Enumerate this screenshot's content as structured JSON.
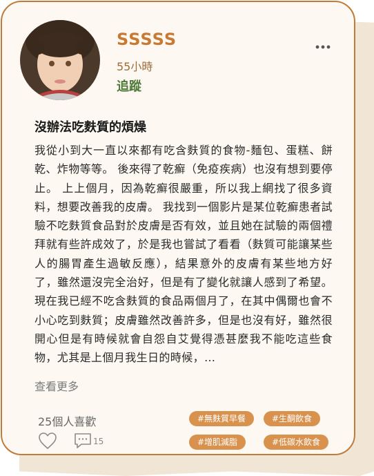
{
  "post": {
    "username": "SSSSS",
    "time": "55小時",
    "follow_label": "追蹤",
    "title": "沒辦法吃麩質的煩燥",
    "body": "我從小到大一直以來都有吃含麩質的食物-麵包、蛋糕、餅乾、炸物等等。 後來得了乾癬（免疫疾病）也沒有想到要停止。 上上個月，因為乾癬很嚴重，所以我上網找了很多資料，想要改善我的皮膚。 我找到一個影片是某位乾癬患者試驗不吃麩質食品對於皮膚是否有效，並且她在試驗的兩個禮拜就有些許成效了，於是我也嘗試了看看（麩質可能讓某些人的腸胃產生過敏反應），結果意外的皮膚有某些地方好了，雖然還沒完全治好，但是有了變化就讓人感到了希望。 現在我已經不吃含麩質的食品兩個月了，在其中偶爾也會不小心吃到麩質；皮膚雖然改善許多，但是也沒有好，雖然很開心但是有時候就會自怨自艾覺得憑甚麼我不能吃這些食物，尤其是上個月我生日的時候，…",
    "see_more": "查看更多",
    "likes_text": "25個人喜歡",
    "comment_count": "15",
    "tags": [
      "#無麩質早餐",
      "#生酮飲食",
      "#增肌減脂",
      "#低碳水飲食"
    ]
  },
  "icons": {
    "more": "more-horizontal-icon",
    "heart": "heart-icon",
    "comment": "comment-icon"
  },
  "colors": {
    "accent": "#c87a33",
    "follow": "#4f7a3a",
    "tag_bg": "#d9924e",
    "card_bg": "#fdf9f2",
    "border": "#c07a3a"
  }
}
